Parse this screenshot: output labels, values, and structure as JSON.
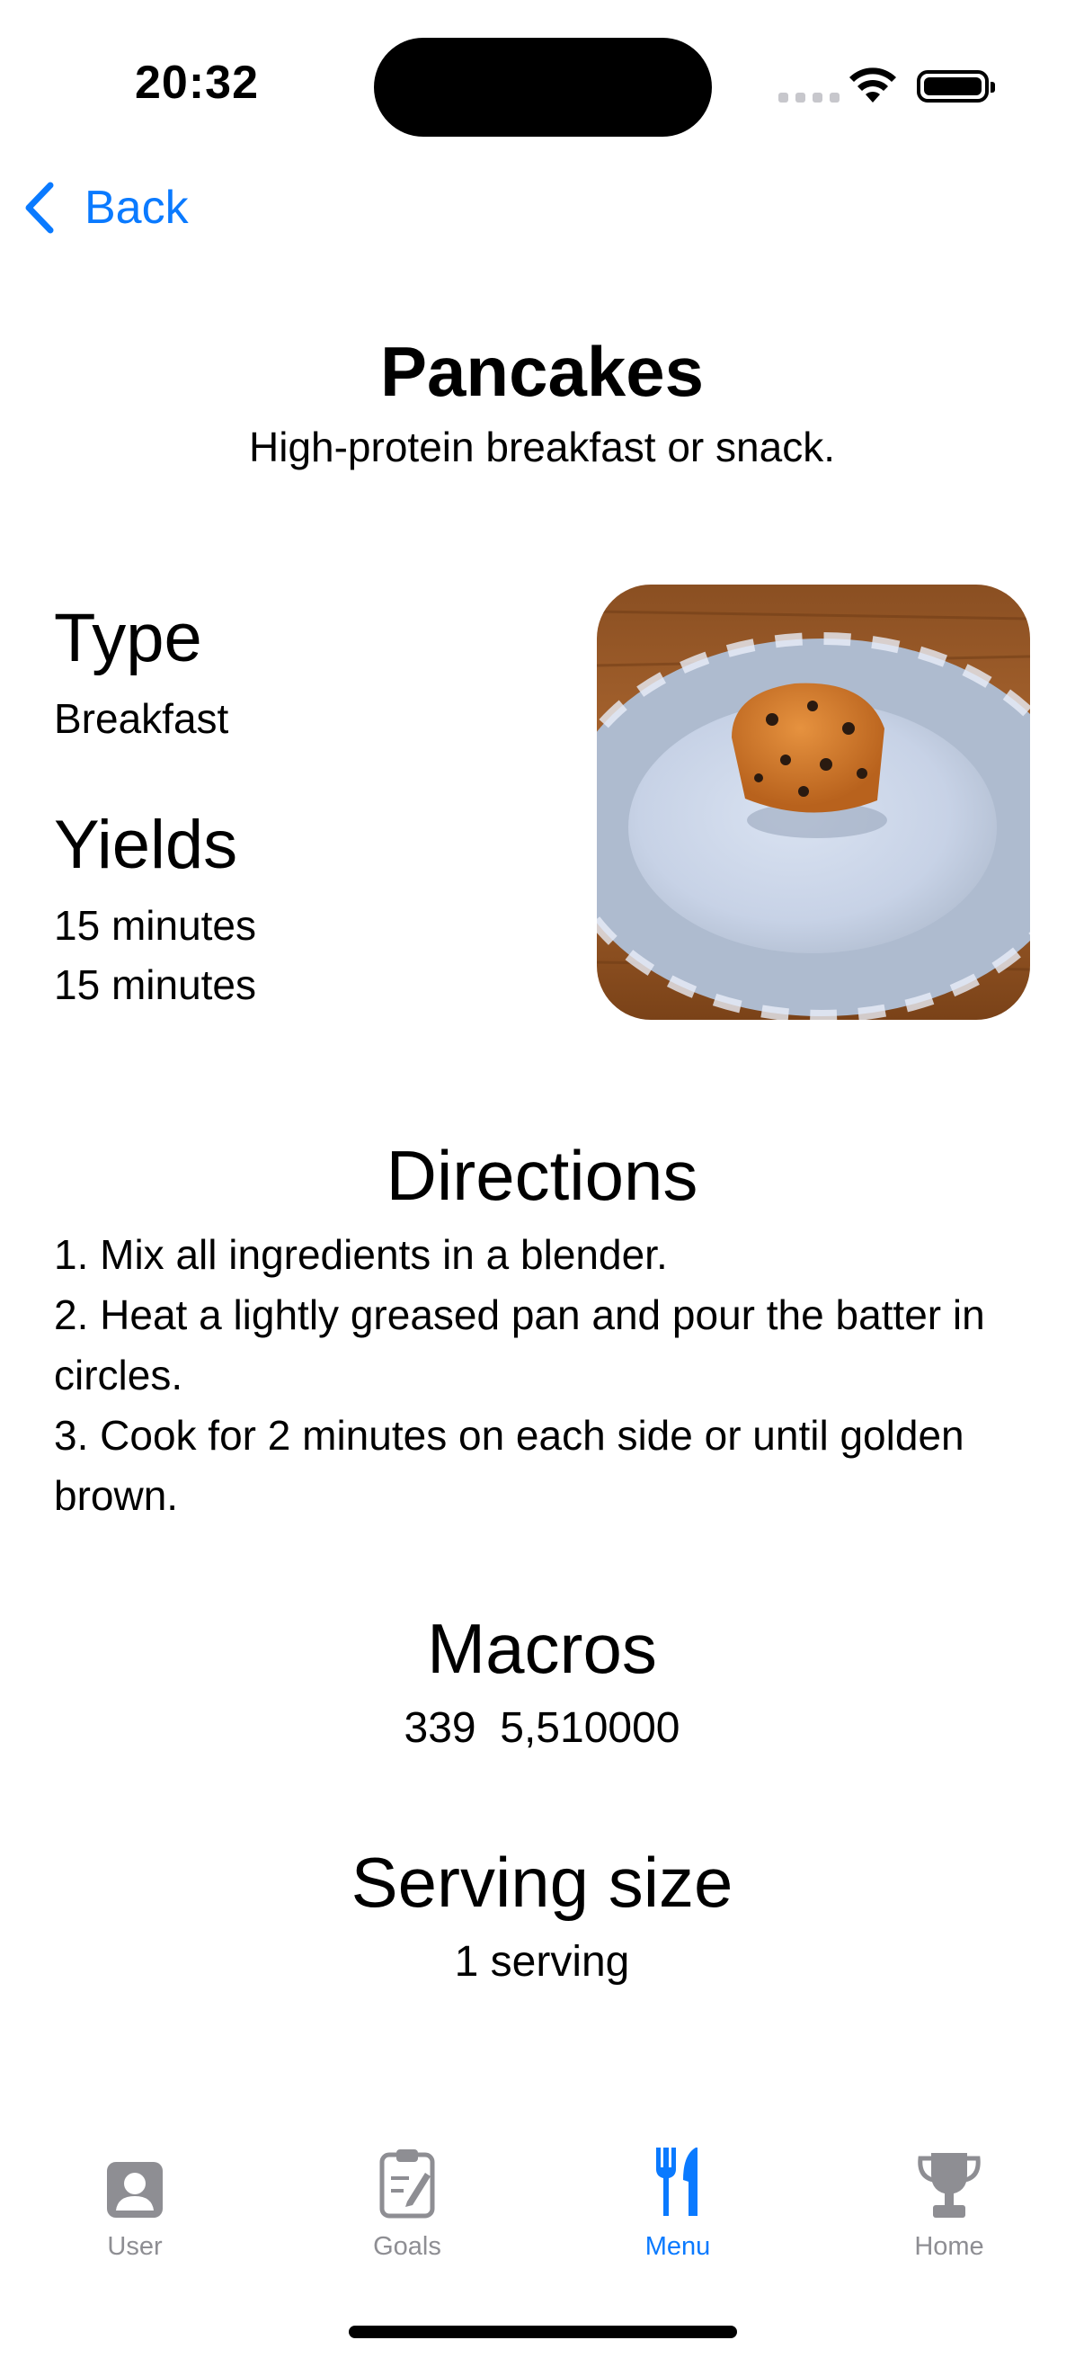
{
  "status_bar": {
    "time": "20:32"
  },
  "nav": {
    "back_label": "Back"
  },
  "recipe": {
    "title": "Pancakes",
    "subtitle": "High-protein breakfast or snack.",
    "type_heading": "Type",
    "type_value": "Breakfast",
    "yields_heading": "Yields",
    "yields_lines": [
      "15 minutes",
      "15 minutes"
    ],
    "image_alt": "muffin on plate",
    "directions_heading": "Directions",
    "directions": [
      "1. Mix all ingredients in a blender.",
      "2. Heat a lightly greased pan and pour the batter in circles.",
      "3. Cook for 2 minutes on each side or until golden brown."
    ],
    "macros_heading": "Macros",
    "macros_value": "339  5,510000",
    "serving_heading": "Serving size",
    "serving_value": "1 serving"
  },
  "tabs": [
    {
      "label": "User",
      "icon": "person-icon",
      "active": false
    },
    {
      "label": "Goals",
      "icon": "clipboard-icon",
      "active": false
    },
    {
      "label": "Menu",
      "icon": "fork-knife-icon",
      "active": true
    },
    {
      "label": "Home",
      "icon": "trophy-icon",
      "active": false
    }
  ],
  "colors": {
    "accent": "#0a7aff",
    "inactive": "#8e8e93"
  }
}
